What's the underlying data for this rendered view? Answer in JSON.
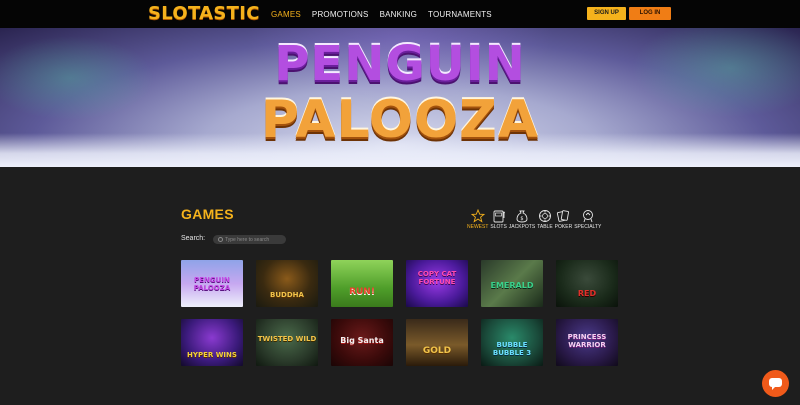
{
  "header": {
    "logo": "SLOTASTIC",
    "nav": [
      "GAMES",
      "PROMOTIONS",
      "BANKING",
      "TOURNAMENTS"
    ],
    "signup_label": "SIGN UP",
    "login_label": "LOG IN"
  },
  "banner": {
    "line1": "PENGUIN",
    "line2": "PALOOZA"
  },
  "games": {
    "title": "GAMES",
    "search_label": "Search:",
    "search_placeholder": "Type here to search",
    "categories": [
      {
        "label": "NEWEST",
        "icon": "star-icon"
      },
      {
        "label": "SLOTS",
        "icon": "slot-machine-icon"
      },
      {
        "label": "JACKPOTS",
        "icon": "money-bag-icon"
      },
      {
        "label": "TABLE",
        "icon": "chip-icon"
      },
      {
        "label": "POKER",
        "icon": "cards-icon"
      },
      {
        "label": "SPECIALTY",
        "icon": "specialty-icon"
      }
    ],
    "row1": [
      {
        "label": "PENGUIN PALOOZA"
      },
      {
        "label": "BUDDHA"
      },
      {
        "label": "RUN!"
      },
      {
        "label": "COPY CAT FORTUNE"
      },
      {
        "label": "EMERALD"
      },
      {
        "label": "RED"
      }
    ],
    "row2": [
      {
        "label": "HYPER WINS"
      },
      {
        "label": "TWISTED WILD"
      },
      {
        "label": "Big Santa"
      },
      {
        "label": "GOLD"
      },
      {
        "label": "BUBBLE BUBBLE 3"
      },
      {
        "label": "PRINCESS WARRIOR"
      }
    ]
  },
  "colors": {
    "accent": "#f5b21c",
    "login": "#f07d15",
    "chat": "#f05a1a",
    "page_bg": "#1e1e1e"
  }
}
